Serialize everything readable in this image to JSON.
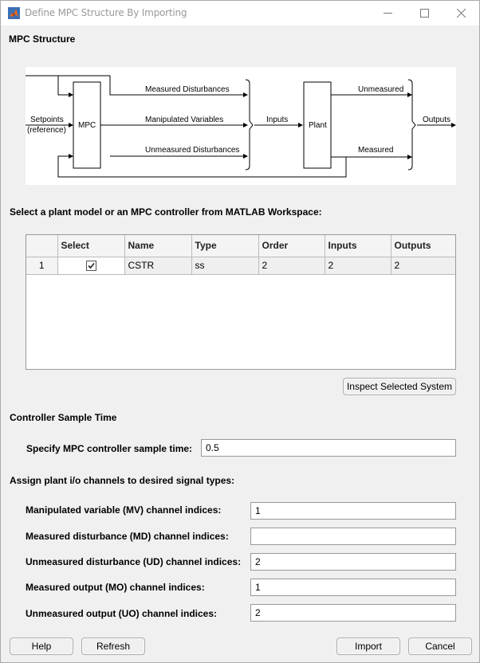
{
  "window": {
    "title": "Define MPC Structure By Importing",
    "controls": {
      "minimize": "—",
      "maximize": "☐",
      "close": "✕"
    }
  },
  "mpc_structure": {
    "heading": "MPC Structure",
    "diagram": {
      "setpoints": "Setpoints",
      "reference": "(reference)",
      "mpc_block": "MPC",
      "measured_disturbances": "Measured Disturbances",
      "manipulated_variables": "Manipulated Variables",
      "unmeasured_disturbances": "Unmeasured Disturbances",
      "inputs": "Inputs",
      "plant_block": "Plant",
      "unmeasured": "Unmeasured",
      "measured": "Measured",
      "outputs": "Outputs"
    }
  },
  "workspace": {
    "heading": "Select a plant model or an MPC controller from MATLAB Workspace:",
    "columns": [
      "",
      "Select",
      "Name",
      "Type",
      "Order",
      "Inputs",
      "Outputs"
    ],
    "rows": [
      {
        "index": "1",
        "selected": true,
        "name": "CSTR",
        "type": "ss",
        "order": "2",
        "inputs": "2",
        "outputs": "2"
      }
    ],
    "inspect_button": "Inspect Selected System"
  },
  "sample_time": {
    "heading": "Controller Sample Time",
    "label": "Specify MPC controller sample time:",
    "value": "0.5"
  },
  "channels": {
    "heading": "Assign plant i/o channels to desired signal types:",
    "fields": [
      {
        "label": "Manipulated variable (MV) channel indices:",
        "value": "1"
      },
      {
        "label": "Measured disturbance (MD) channel indices:",
        "value": ""
      },
      {
        "label": "Unmeasured disturbance (UD) channel indices:",
        "value": "2"
      },
      {
        "label": "Measured output (MO) channel indices:",
        "value": "1"
      },
      {
        "label": "Unmeasured output (UO) channel indices:",
        "value": "2"
      }
    ]
  },
  "buttons": {
    "help": "Help",
    "refresh": "Refresh",
    "import": "Import",
    "cancel": "Cancel"
  }
}
